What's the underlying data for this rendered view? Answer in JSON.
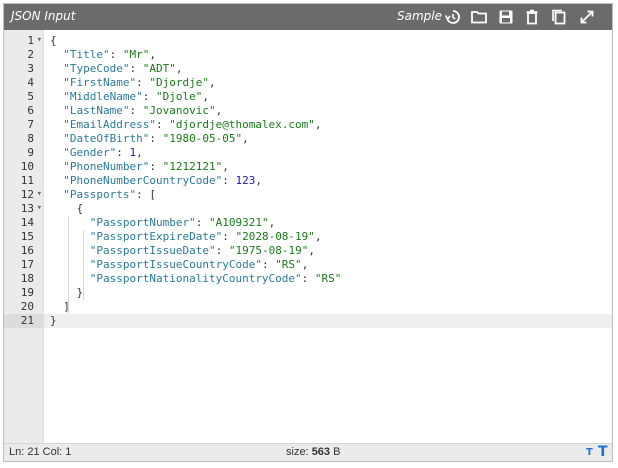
{
  "toolbar": {
    "title": "JSON Input",
    "sample_label": "Sample",
    "icons": [
      "history-icon",
      "folder-icon",
      "save-icon",
      "trash-icon",
      "copy-icon",
      "expand-icon"
    ]
  },
  "editor": {
    "lines": [
      {
        "n": "1",
        "fold": true,
        "text": "{"
      },
      {
        "n": "2",
        "fold": false,
        "text": "  \"Title\": \"Mr\","
      },
      {
        "n": "3",
        "fold": false,
        "text": "  \"TypeCode\": \"ADT\","
      },
      {
        "n": "4",
        "fold": false,
        "text": "  \"FirstName\": \"Djordje\","
      },
      {
        "n": "5",
        "fold": false,
        "text": "  \"MiddleName\": \"Djole\","
      },
      {
        "n": "6",
        "fold": false,
        "text": "  \"LastName\": \"Jovanovic\","
      },
      {
        "n": "7",
        "fold": false,
        "text": "  \"EmailAddress\": \"djordje@thomalex.com\","
      },
      {
        "n": "8",
        "fold": false,
        "text": "  \"DateOfBirth\": \"1980-05-05\","
      },
      {
        "n": "9",
        "fold": false,
        "text": "  \"Gender\": 1,"
      },
      {
        "n": "10",
        "fold": false,
        "text": "  \"PhoneNumber\": \"1212121\","
      },
      {
        "n": "11",
        "fold": false,
        "text": "  \"PhoneNumberCountryCode\": 123,"
      },
      {
        "n": "12",
        "fold": true,
        "text": "  \"Passports\": ["
      },
      {
        "n": "13",
        "fold": true,
        "text": "    {"
      },
      {
        "n": "14",
        "fold": false,
        "text": "      \"PassportNumber\": \"A109321\","
      },
      {
        "n": "15",
        "fold": false,
        "text": "      \"PassportExpireDate\": \"2028-08-19\","
      },
      {
        "n": "16",
        "fold": false,
        "text": "      \"PassportIssueDate\": \"1975-08-19\","
      },
      {
        "n": "17",
        "fold": false,
        "text": "      \"PassportIssueCountryCode\": \"RS\","
      },
      {
        "n": "18",
        "fold": false,
        "text": "      \"PassportNationalityCountryCode\": \"RS\""
      },
      {
        "n": "19",
        "fold": false,
        "text": "    }"
      },
      {
        "n": "20",
        "fold": false,
        "text": "  ]"
      },
      {
        "n": "21",
        "fold": false,
        "text": "}"
      }
    ],
    "active_line": 21
  },
  "status": {
    "position": "Ln: 21 Col: 1",
    "size_prefix": "size: ",
    "size_value": "563",
    "size_unit": " B",
    "text_small": "T",
    "text_large": "T"
  },
  "colors": {
    "key": "#2a7a9a",
    "string": "#1a7a1a",
    "number": "#1a1aa6",
    "toolbar": "#6b6b6b",
    "accent": "#1e72d6"
  }
}
